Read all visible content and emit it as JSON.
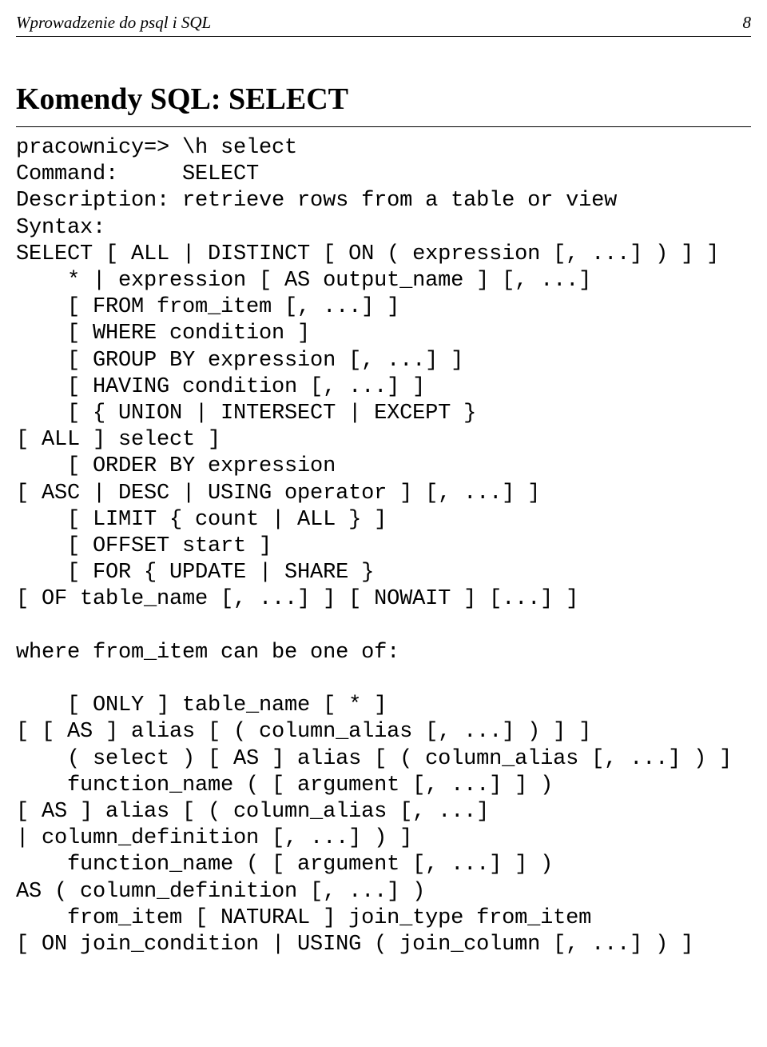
{
  "header": {
    "title": "Wprowadzenie do psql i SQL",
    "page": "8"
  },
  "section": {
    "title": "Komendy SQL: SELECT"
  },
  "code": {
    "l0": "pracownicy=> \\h select",
    "l1": "Command:     SELECT",
    "l2": "Description: retrieve rows from a table or view",
    "l3": "Syntax:",
    "l4": "SELECT [ ALL | DISTINCT [ ON ( expression [, ...] ) ] ]",
    "l5": "    * | expression [ AS output_name ] [, ...]",
    "l6": "    [ FROM from_item [, ...] ]",
    "l7": "    [ WHERE condition ]",
    "l8": "    [ GROUP BY expression [, ...] ]",
    "l9": "    [ HAVING condition [, ...] ]",
    "l10": "    [ { UNION | INTERSECT | EXCEPT }",
    "l11": "[ ALL ] select ]",
    "l12": "    [ ORDER BY expression",
    "l13": "[ ASC | DESC | USING operator ] [, ...] ]",
    "l14": "    [ LIMIT { count | ALL } ]",
    "l15": "    [ OFFSET start ]",
    "l16": "    [ FOR { UPDATE | SHARE }",
    "l17": "[ OF table_name [, ...] ] [ NOWAIT ] [...] ]",
    "l18": "",
    "l19": "where from_item can be one of:",
    "l20": "",
    "l21": "    [ ONLY ] table_name [ * ]",
    "l22": "[ [ AS ] alias [ ( column_alias [, ...] ) ] ]",
    "l23": "    ( select ) [ AS ] alias [ ( column_alias [, ...] ) ]",
    "l24": "    function_name ( [ argument [, ...] ] )",
    "l25": "[ AS ] alias [ ( column_alias [, ...]",
    "l26": "| column_definition [, ...] ) ]",
    "l27": "    function_name ( [ argument [, ...] ] )",
    "l28": "AS ( column_definition [, ...] )",
    "l29": "    from_item [ NATURAL ] join_type from_item",
    "l30": "[ ON join_condition | USING ( join_column [, ...] ) ]"
  }
}
